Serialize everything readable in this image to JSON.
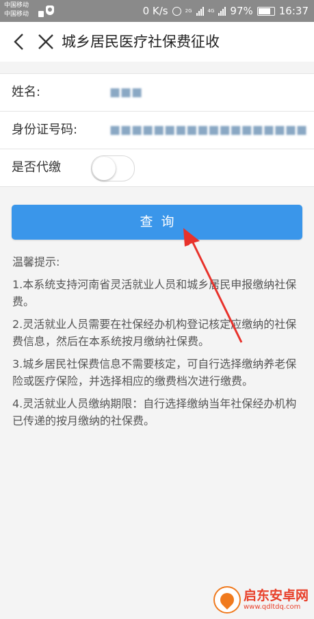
{
  "status_bar": {
    "carrier1": "中国移动",
    "carrier2": "中国移动",
    "speed": "0 K/s",
    "net1": "2G",
    "net2": "4G",
    "battery": "97%",
    "time": "16:37"
  },
  "header": {
    "title": "城乡居民医疗社保费征收"
  },
  "form": {
    "name_label": "姓名:",
    "name_value": "■■■",
    "id_label": "身份证号码:",
    "id_value": "■■■■■■■■■■■■■■■■■■",
    "proxy_label": "是否代缴",
    "proxy_on": false
  },
  "query_button": "查询",
  "tips": {
    "title": "温馨提示:",
    "items": [
      "1.本系统支持河南省灵活就业人员和城乡居民申报缴纳社保费。",
      "2.灵活就业人员需要在社保经办机构登记核定应缴纳的社保费信息，然后在本系统按月缴纳社保费。",
      "3.城乡居民社保费信息不需要核定，可自行选择缴纳养老保险或医疗保险，并选择相应的缴费档次进行缴费。",
      "4.灵活就业人员缴纳期限：自行选择缴纳当年社保经办机构已传递的按月缴纳的社保费。"
    ]
  },
  "watermark": {
    "name": "启东安卓网",
    "url": "www.qdltdq.com"
  },
  "colors": {
    "primary": "#3a96ea",
    "annotation_arrow": "#e8322b"
  }
}
